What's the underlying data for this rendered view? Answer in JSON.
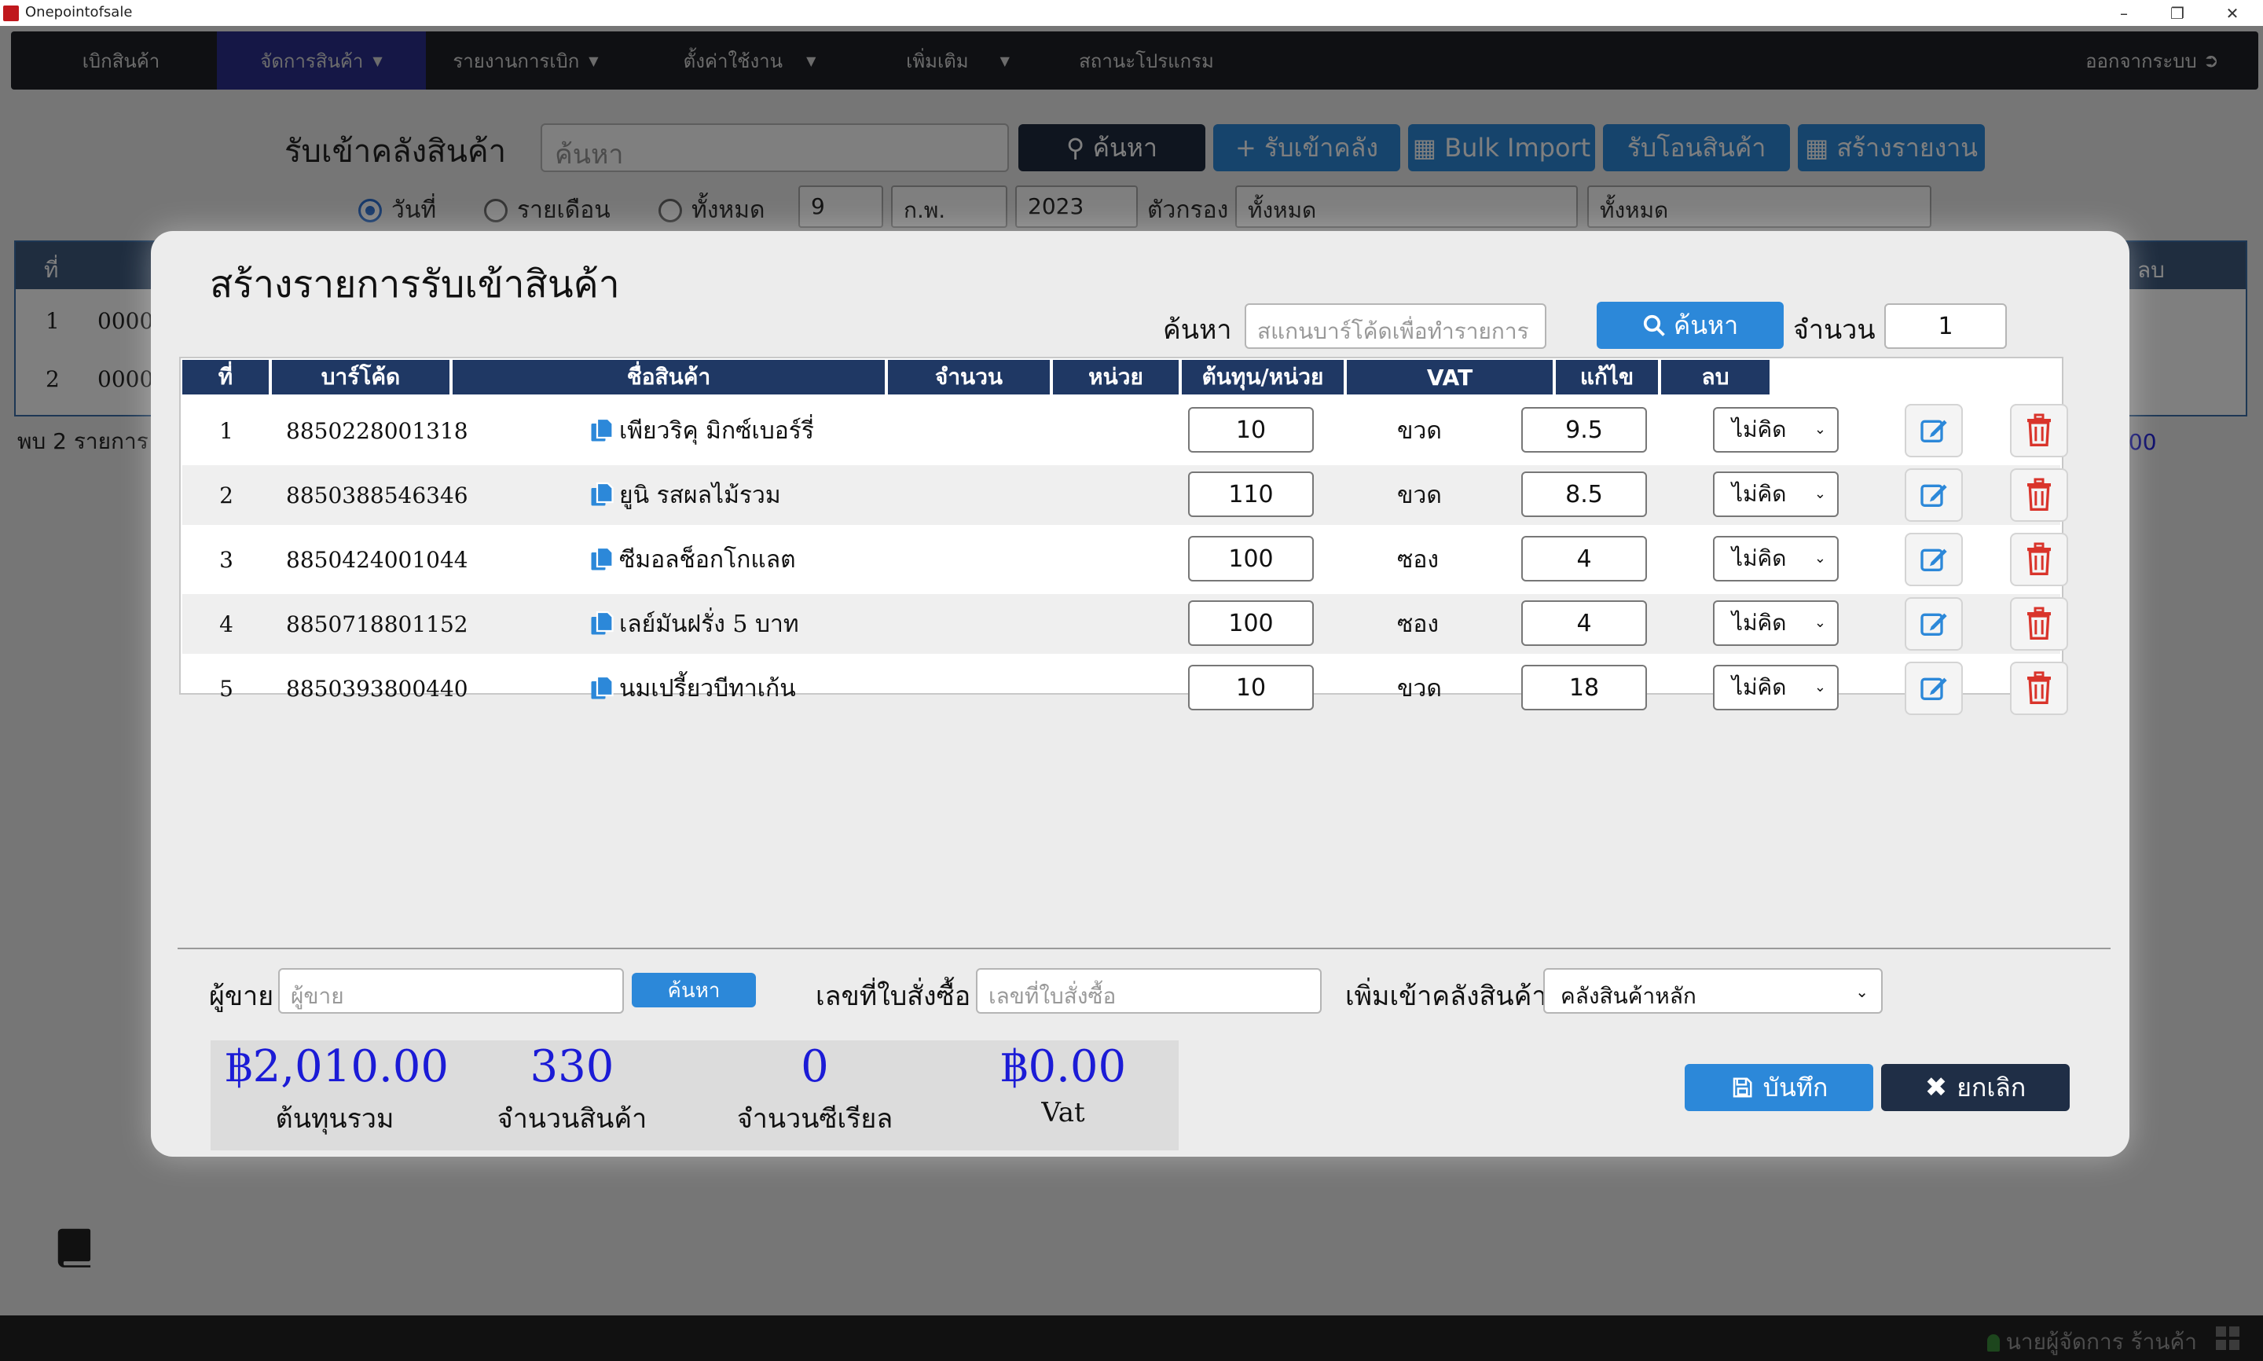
{
  "window": {
    "title": "Onepointofsale"
  },
  "nav": {
    "items": [
      {
        "label": "เบิกสินค้า"
      },
      {
        "label": "จัดการสินค้า"
      },
      {
        "label": "รายงานการเบิก"
      },
      {
        "label": "ตั้งค่าใช้งาน"
      },
      {
        "label": "เพิ่มเติม"
      },
      {
        "label": "สถานะโปรแกรม"
      }
    ],
    "logout": "ออกจากระบบ"
  },
  "page": {
    "title": "รับเข้าคลังสินค้า",
    "search_placeholder": "ค้นหา",
    "buttons": {
      "search": "ค้นหา",
      "receive": "รับเข้าคลัง",
      "bulk_import": "Bulk Import",
      "transfer": "รับโอนสินค้า",
      "create_report": "สร้างรายงาน"
    },
    "filter": {
      "radio_date": "วันที่",
      "radio_month": "รายเดือน",
      "radio_all": "ทั้งหมด",
      "day": "9",
      "month": "ก.พ.",
      "year": "2023",
      "filter_label": "ตัวกรอง",
      "filter_value1": "ทั้งหมด",
      "filter_value2": "ทั้งหมด"
    },
    "table": {
      "col_no": "ที่",
      "col_delete": "ลบ",
      "rows": [
        {
          "no": "1",
          "code": "0000"
        },
        {
          "no": "2",
          "code": "0000"
        }
      ],
      "found": "พบ 2 รายการ",
      "total_partial": ".00"
    }
  },
  "modal": {
    "title": "สร้างรายการรับเข้าสินค้า",
    "search_label": "ค้นหา",
    "search_placeholder": "สแกนบาร์โค้ดเพื่อทำรายการ",
    "search_button": "ค้นหา",
    "qty_label": "จำนวน",
    "qty_value": "1",
    "columns": {
      "no": "ที่",
      "barcode": "บาร์โค้ด",
      "name": "ชื่อสินค้า",
      "qty": "จำนวน",
      "unit": "หน่วย",
      "cost": "ต้นทุน/หน่วย",
      "vat": "VAT",
      "edit": "แก้ไข",
      "delete": "ลบ"
    },
    "rows": [
      {
        "no": "1",
        "barcode": "8850228001318",
        "name": "เพียวริคุ มิกซ์เบอร์รี่",
        "qty": "10",
        "unit": "ขวด",
        "cost": "9.5",
        "vat": "ไม่คิด"
      },
      {
        "no": "2",
        "barcode": "8850388546346",
        "name": "ยูนิ รสผลไม้รวม",
        "qty": "110",
        "unit": "ขวด",
        "cost": "8.5",
        "vat": "ไม่คิด"
      },
      {
        "no": "3",
        "barcode": "8850424001044",
        "name": "ซีมอลช็อกโกแลต",
        "qty": "100",
        "unit": "ซอง",
        "cost": "4",
        "vat": "ไม่คิด"
      },
      {
        "no": "4",
        "barcode": "8850718801152",
        "name": "เลย์มันฝรั่ง 5 บาท",
        "qty": "100",
        "unit": "ซอง",
        "cost": "4",
        "vat": "ไม่คิด"
      },
      {
        "no": "5",
        "barcode": "8850393800440",
        "name": "นมเปรี้ยวบีทาเก้น",
        "qty": "10",
        "unit": "ขวด",
        "cost": "18",
        "vat": "ไม่คิด"
      }
    ],
    "supplier_label": "ผู้ขาย",
    "supplier_placeholder": "ผู้ขาย",
    "supplier_search": "ค้นหา",
    "po_label": "เลขที่ใบสั่งซื้อ",
    "po_placeholder": "เลขที่ใบสั่งซื้อ",
    "warehouse_label": "เพิ่มเข้าคลังสินค้า",
    "warehouse_value": "คลังสินค้าหลัก",
    "summary": {
      "total_cost": "฿2,010.00",
      "total_cost_label": "ต้นทุนรวม",
      "item_count": "330",
      "item_count_label": "จำนวนสินค้า",
      "serial_count": "0",
      "serial_count_label": "จำนวนซีเรียล",
      "vat": "฿0.00",
      "vat_label": "Vat"
    },
    "save": "บันทึก",
    "cancel": "ยกเลิก"
  },
  "footer": {
    "user": "นายผู้จัดการ ร้านค้า"
  },
  "colors": {
    "accent": "#2c88d9",
    "header": "#1f3864",
    "danger": "#d9342b",
    "summary_value": "#1b1bd6"
  }
}
